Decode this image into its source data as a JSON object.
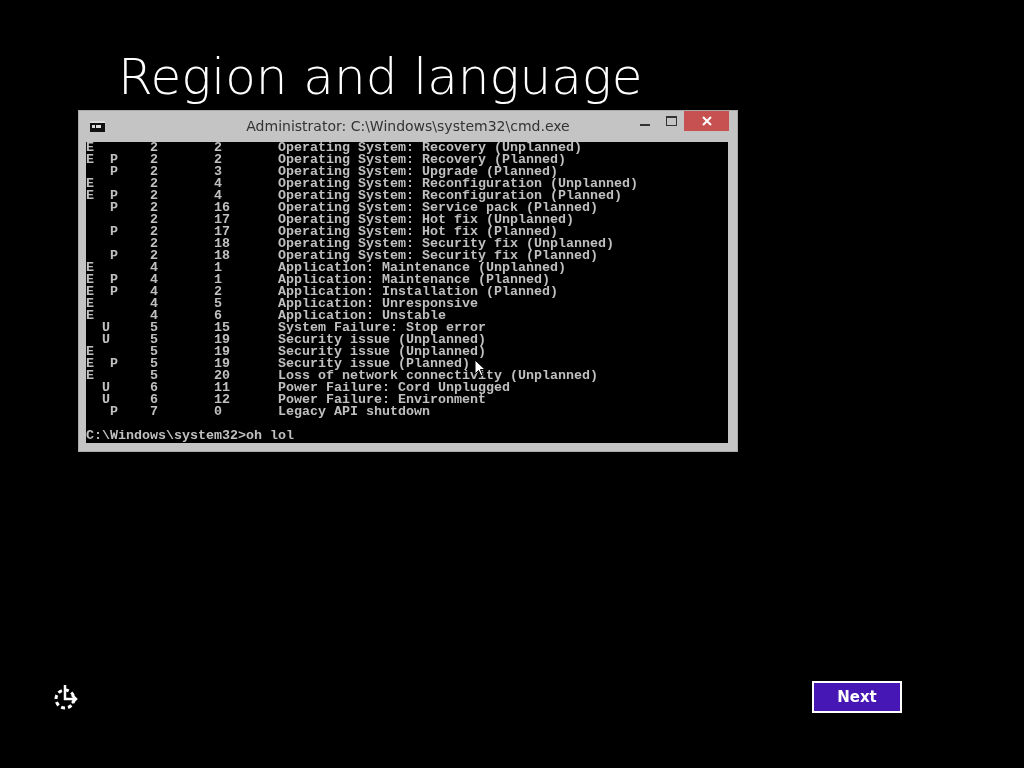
{
  "page": {
    "title": "Region and language"
  },
  "window": {
    "title": "Administrator: C:\\Windows\\system32\\cmd.exe",
    "rows": [
      {
        "e": "E",
        "class": "2",
        "code": "2",
        "description": "Operating System: Recovery (Unplanned)"
      },
      {
        "e": "E",
        "p": "P",
        "class": "2",
        "code": "2",
        "description": "Operating System: Recovery (Planned)"
      },
      {
        "p": "P",
        "class": "2",
        "code": "3",
        "description": "Operating System: Upgrade (Planned)"
      },
      {
        "e": "E",
        "class": "2",
        "code": "4",
        "description": "Operating System: Reconfiguration (Unplanned)"
      },
      {
        "e": "E",
        "p": "P",
        "class": "2",
        "code": "4",
        "description": "Operating System: Reconfiguration (Planned)"
      },
      {
        "p": "P",
        "class": "2",
        "code": "16",
        "description": "Operating System: Service pack (Planned)"
      },
      {
        "class": "2",
        "code": "17",
        "description": "Operating System: Hot fix (Unplanned)"
      },
      {
        "p": "P",
        "class": "2",
        "code": "17",
        "description": "Operating System: Hot fix (Planned)"
      },
      {
        "class": "2",
        "code": "18",
        "description": "Operating System: Security fix (Unplanned)"
      },
      {
        "p": "P",
        "class": "2",
        "code": "18",
        "description": "Operating System: Security fix (Planned)"
      },
      {
        "e": "E",
        "class": "4",
        "code": "1",
        "description": "Application: Maintenance (Unplanned)"
      },
      {
        "e": "E",
        "p": "P",
        "class": "4",
        "code": "1",
        "description": "Application: Maintenance (Planned)"
      },
      {
        "e": "E",
        "p": "P",
        "class": "4",
        "code": "2",
        "description": "Application: Installation (Planned)"
      },
      {
        "e": "E",
        "class": "4",
        "code": "5",
        "description": "Application: Unresponsive"
      },
      {
        "e": "E",
        "class": "4",
        "code": "6",
        "description": "Application: Unstable"
      },
      {
        "u": "U",
        "class": "5",
        "code": "15",
        "description": "System Failure: Stop error"
      },
      {
        "u": "U",
        "class": "5",
        "code": "19",
        "description": "Security issue (Unplanned)"
      },
      {
        "e": "E",
        "class": "5",
        "code": "19",
        "description": "Security issue (Unplanned)"
      },
      {
        "e": "E",
        "p": "P",
        "class": "5",
        "code": "19",
        "description": "Security issue (Planned)"
      },
      {
        "e": "E",
        "class": "5",
        "code": "20",
        "description": "Loss of network connectivity (Unplanned)"
      },
      {
        "u": "U",
        "class": "6",
        "code": "11",
        "description": "Power Failure: Cord Unplugged"
      },
      {
        "u": "U",
        "class": "6",
        "code": "12",
        "description": "Power Failure: Environment"
      },
      {
        "p": "P",
        "class": "7",
        "code": "0",
        "description": "Legacy API shutdown"
      }
    ],
    "prompt": "C:\\Windows\\system32>oh lol"
  },
  "next_button": "Next"
}
